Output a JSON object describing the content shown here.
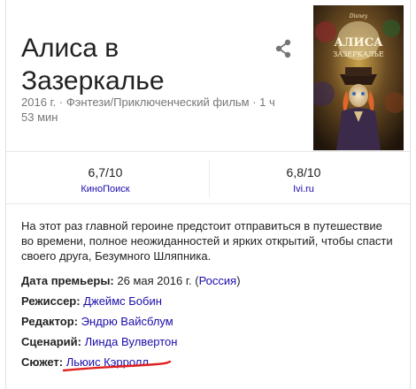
{
  "title": "Алиса в Зазеркалье",
  "meta": "2016 г. · Фэнтези/Приключенческий фильм · 1 ч 53 мин",
  "poster": {
    "title_line1": "АЛИСА",
    "title_line2": "ЗАЗЕРКАЛЬЕ",
    "brand": "Disney"
  },
  "ratings": [
    {
      "value": "6,7/10",
      "source": "КиноПоиск"
    },
    {
      "value": "6,8/10",
      "source": "Ivi.ru"
    }
  ],
  "description": "На этот раз главной героине предстоит отправиться в путешествие во времени, полное неожиданностей и ярких открытий, чтобы спасти своего друга, Безумного Шляпника.",
  "facts": {
    "premiere": {
      "label": "Дата премьеры:",
      "value": "26 мая 2016 г.",
      "paren_open": "(",
      "country": "Россия",
      "paren_close": ")"
    },
    "director": {
      "label": "Режиссер:",
      "value": "Джеймс Бобин"
    },
    "editor": {
      "label": "Редактор:",
      "value": "Эндрю Вайсблум"
    },
    "writer": {
      "label": "Сценарий:",
      "value": "Линда Вулвертон"
    },
    "story": {
      "label": "Сюжет:",
      "value": "Льюис Кэрролл"
    }
  },
  "colors": {
    "link": "#1a0dab",
    "meta": "#777777",
    "annotation": "#e02020"
  },
  "icons": {
    "share": "share-icon"
  }
}
